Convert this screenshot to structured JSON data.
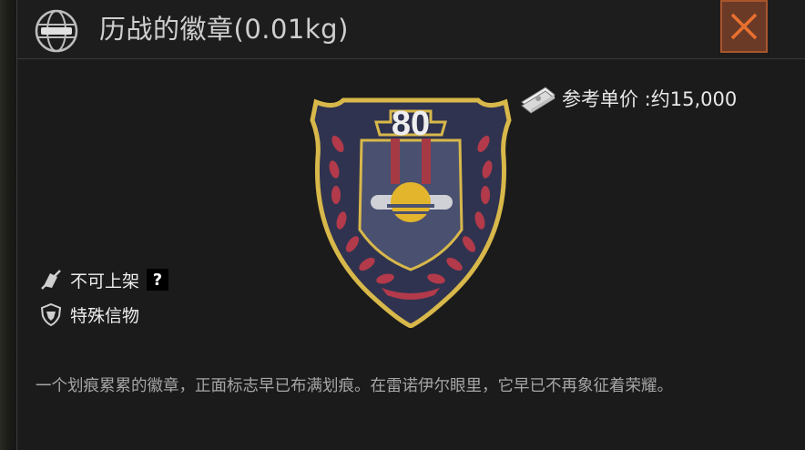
{
  "header": {
    "title": "历战的徽章(0.01kg)"
  },
  "price": {
    "label": "参考单价 :",
    "value": "约15,000"
  },
  "badge": {
    "number": "80"
  },
  "tags": [
    {
      "label": "不可上架",
      "icon": "no-listing-icon"
    },
    {
      "label": "特殊信物",
      "icon": "special-token-icon"
    }
  ],
  "help": {
    "label": "?"
  },
  "description": "一个划痕累累的徽章，正面标志早已布满划痕。在雷诺伊尔眼里，它早已不再象征着荣耀。",
  "colors": {
    "panel_bg": "#1b1b1b",
    "close_bg": "#6a3a26",
    "close_x": "#e8702f",
    "badge_gold": "#d8b84a",
    "badge_navy": "#2f3350",
    "laurel_red": "#b23a4a"
  }
}
